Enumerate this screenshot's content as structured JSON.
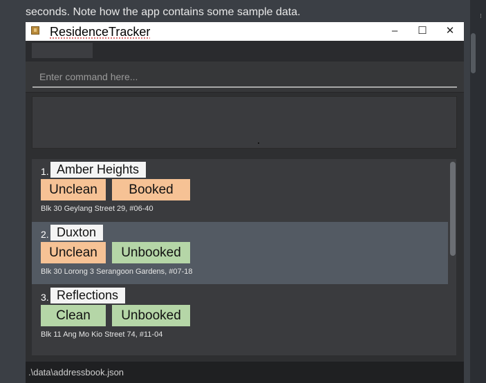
{
  "doc": {
    "text": "seconds. Note how the app contains some sample data."
  },
  "window": {
    "title": "ResidenceTracker",
    "controls": {
      "minimize": "–",
      "maximize": "☐",
      "close": "✕"
    }
  },
  "command": {
    "placeholder": "Enter command here..."
  },
  "residences": [
    {
      "index": "1.",
      "name": "Amber Heights",
      "clean": "Unclean",
      "booking": "Booked",
      "address": "Blk 30 Geylang Street 29, #06-40"
    },
    {
      "index": "2.",
      "name": "Duxton",
      "clean": "Unclean",
      "booking": "Unbooked",
      "address": "Blk 30 Lorong 3 Serangoon Gardens, #07-18"
    },
    {
      "index": "3.",
      "name": "Reflections",
      "clean": "Clean",
      "booking": "Unbooked",
      "address": "Blk 11 Ang Mo Kio Street 74, #11-04"
    }
  ],
  "status": {
    "file_path": ".\\data\\addressbook.json"
  },
  "colors": {
    "tag_orange": "#f6c295",
    "tag_green": "#b5d6a7",
    "selected_row": "#535a63"
  }
}
